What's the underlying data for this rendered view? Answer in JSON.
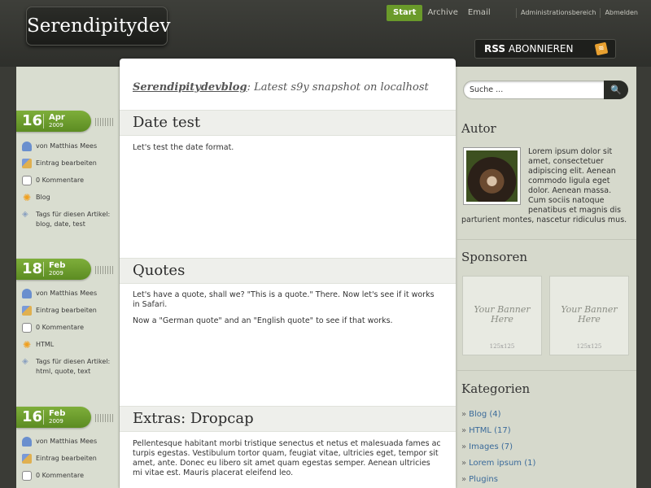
{
  "site": {
    "logo": "Serendipitydev"
  },
  "topnav": {
    "start": "Start",
    "archive": "Archive",
    "email": "Email"
  },
  "adminnav": {
    "admin": "Administrationsbereich",
    "logout": "Abmelden"
  },
  "rss": {
    "bold": "RSS",
    "label": "ABONNIEREN"
  },
  "blog": {
    "title_link": "Serendipitydevblog",
    "title_rest": ": Latest s9y snapshot on localhost"
  },
  "posts": [
    {
      "title": "Date test",
      "day": "16",
      "month": "Apr",
      "year": "2009",
      "author": "von Matthias Mees",
      "edit": "Eintrag bearbeiten",
      "comments": "0 Kommentare",
      "category": "Blog",
      "tags_label": "Tags für diesen Artikel:",
      "tags": "blog, date, test",
      "body": [
        "Let's test the date format."
      ]
    },
    {
      "title": "Quotes",
      "day": "18",
      "month": "Feb",
      "year": "2009",
      "author": "von Matthias Mees",
      "edit": "Eintrag bearbeiten",
      "comments": "0 Kommentare",
      "category": "HTML",
      "tags_label": "Tags für diesen Artikel:",
      "tags": "html, quote, text",
      "body": [
        "Let's have a quote, shall we? \"This is a quote.\" There. Now let's see if it works in Safari.",
        "Now a \"German quote\" and an \"English quote\" to see if that works."
      ]
    },
    {
      "title": "Extras: Dropcap",
      "day": "16",
      "month": "Feb",
      "year": "2009",
      "author": "von Matthias Mees",
      "edit": "Eintrag bearbeiten",
      "comments": "0 Kommentare",
      "body": [
        "Pellentesque habitant morbi tristique senectus et netus et malesuada fames ac turpis egestas. Vestibulum tortor quam, feugiat vitae, ultricies eget, tempor sit amet, ante. Donec eu libero sit amet quam egestas semper. Aenean ultricies mi vitae est. Mauris placerat eleifend leo."
      ]
    }
  ],
  "sidebar": {
    "search_placeholder": "Suche ...",
    "search_button": "🔍",
    "autor_title": "Autor",
    "autor_text": "Lorem ipsum dolor sit amet, consectetuer adipiscing elit. Aenean commodo ligula eget dolor. Aenean massa. Cum sociis natoque penatibus et magnis dis parturient montes, nascetur ridiculus mus.",
    "sponsoren_title": "Sponsoren",
    "banner_text_1": "Your Banner",
    "banner_text_2": "Here",
    "banner_size": "125x125",
    "kategorien_title": "Kategorien",
    "categories": [
      "Blog (4)",
      "HTML (17)",
      "Images (7)",
      "Lorem ipsum (1)",
      "Plugins"
    ]
  },
  "colors": {
    "accent_green": "#6a9a2a",
    "link_blue": "#3a6a9a",
    "header_dark": "#2e2f2b"
  }
}
